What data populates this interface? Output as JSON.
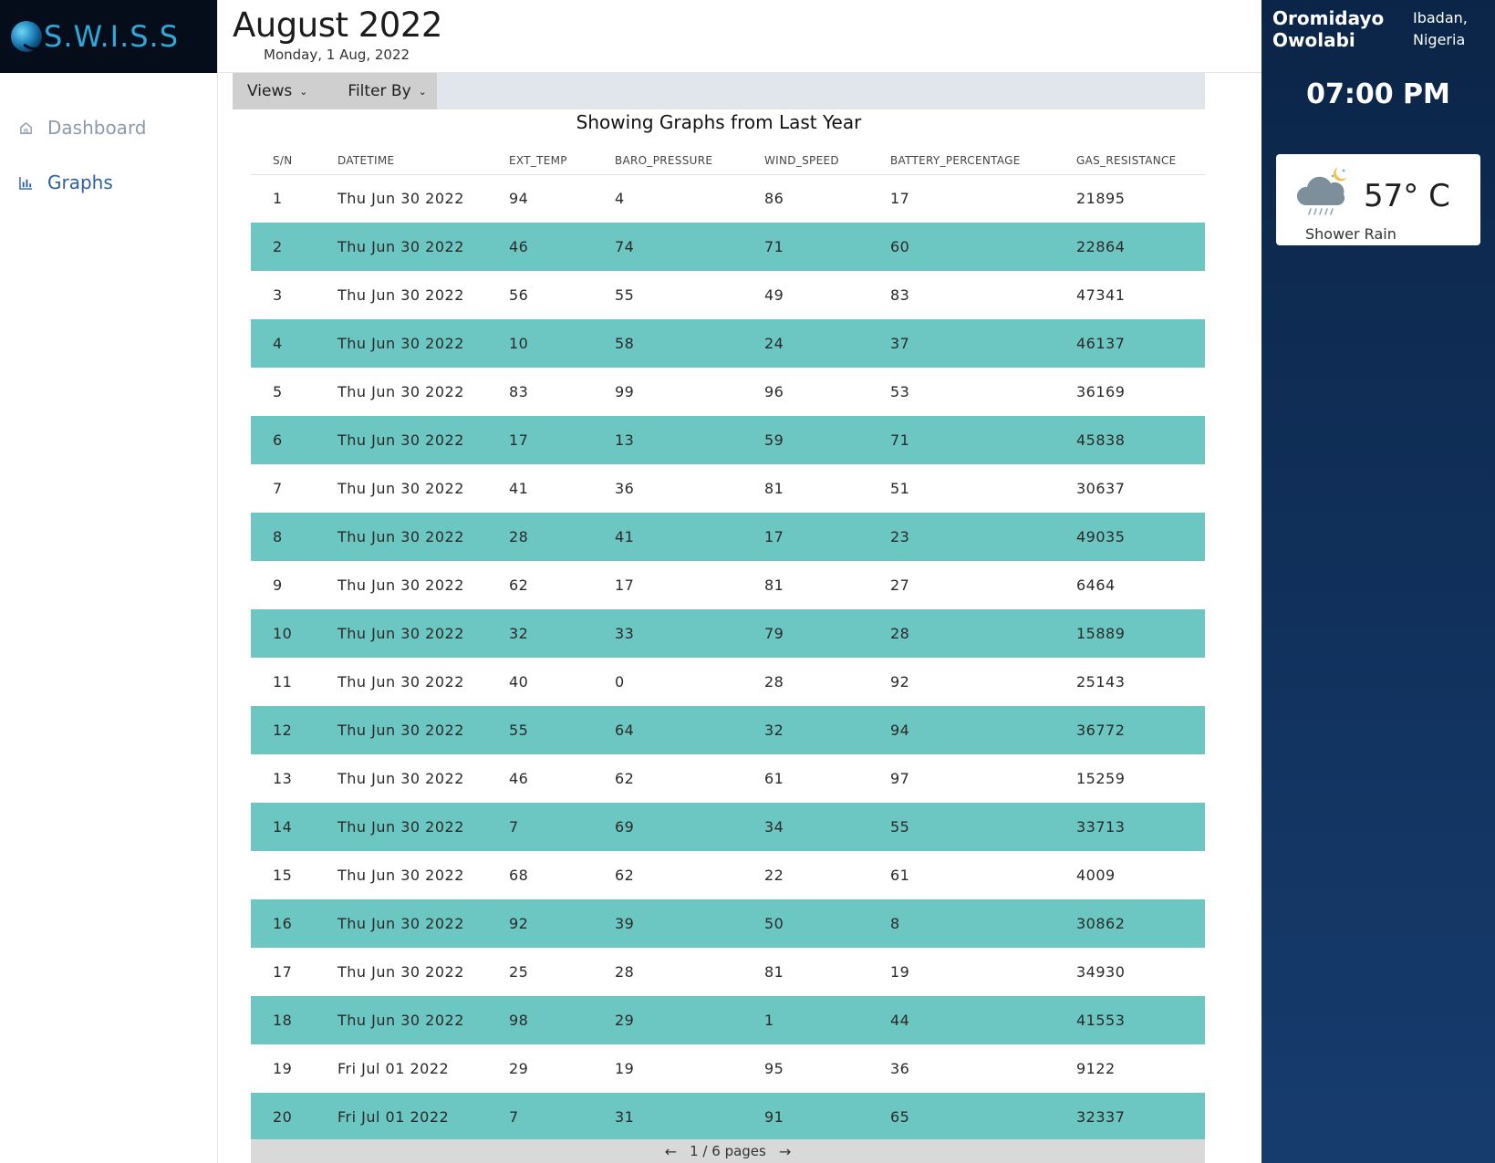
{
  "brand": {
    "logo_text": "S.W.I.S.S"
  },
  "sidebar": {
    "items": [
      {
        "label": "Dashboard",
        "icon": "home-icon"
      },
      {
        "label": "Graphs",
        "icon": "bar-chart-icon"
      }
    ]
  },
  "header": {
    "title": "August 2022",
    "date": "Monday, 1 Aug, 2022"
  },
  "toolbar": {
    "views_label": "Views",
    "filter_label": "Filter By"
  },
  "section_title": "Showing Graphs from Last Year",
  "table": {
    "columns": [
      "S/N",
      "DATETIME",
      "EXT_TEMP",
      "BARO_PRESSURE",
      "WIND_SPEED",
      "BATTERY_PERCENTAGE",
      "GAS_RESISTANCE"
    ],
    "rows": [
      [
        "1",
        "Thu Jun 30 2022",
        "94",
        "4",
        "86",
        "17",
        "21895"
      ],
      [
        "2",
        "Thu Jun 30 2022",
        "46",
        "74",
        "71",
        "60",
        "22864"
      ],
      [
        "3",
        "Thu Jun 30 2022",
        "56",
        "55",
        "49",
        "83",
        "47341"
      ],
      [
        "4",
        "Thu Jun 30 2022",
        "10",
        "58",
        "24",
        "37",
        "46137"
      ],
      [
        "5",
        "Thu Jun 30 2022",
        "83",
        "99",
        "96",
        "53",
        "36169"
      ],
      [
        "6",
        "Thu Jun 30 2022",
        "17",
        "13",
        "59",
        "71",
        "45838"
      ],
      [
        "7",
        "Thu Jun 30 2022",
        "41",
        "36",
        "81",
        "51",
        "30637"
      ],
      [
        "8",
        "Thu Jun 30 2022",
        "28",
        "41",
        "17",
        "23",
        "49035"
      ],
      [
        "9",
        "Thu Jun 30 2022",
        "62",
        "17",
        "81",
        "27",
        "6464"
      ],
      [
        "10",
        "Thu Jun 30 2022",
        "32",
        "33",
        "79",
        "28",
        "15889"
      ],
      [
        "11",
        "Thu Jun 30 2022",
        "40",
        "0",
        "28",
        "92",
        "25143"
      ],
      [
        "12",
        "Thu Jun 30 2022",
        "55",
        "64",
        "32",
        "94",
        "36772"
      ],
      [
        "13",
        "Thu Jun 30 2022",
        "46",
        "62",
        "61",
        "97",
        "15259"
      ],
      [
        "14",
        "Thu Jun 30 2022",
        "7",
        "69",
        "34",
        "55",
        "33713"
      ],
      [
        "15",
        "Thu Jun 30 2022",
        "68",
        "62",
        "22",
        "61",
        "4009"
      ],
      [
        "16",
        "Thu Jun 30 2022",
        "92",
        "39",
        "50",
        "8",
        "30862"
      ],
      [
        "17",
        "Thu Jun 30 2022",
        "25",
        "28",
        "81",
        "19",
        "34930"
      ],
      [
        "18",
        "Thu Jun 30 2022",
        "98",
        "29",
        "1",
        "44",
        "41553"
      ],
      [
        "19",
        "Fri Jul 01 2022",
        "29",
        "19",
        "95",
        "36",
        "9122"
      ],
      [
        "20",
        "Fri Jul 01 2022",
        "7",
        "31",
        "91",
        "65",
        "32337"
      ]
    ]
  },
  "pagination": {
    "text": "1 / 6 pages",
    "prev_icon": "arrow-left-icon",
    "next_icon": "arrow-right-icon"
  },
  "user": {
    "name": "Oromidayo Owolabi",
    "location": "Ibadan, Nigeria"
  },
  "clock": {
    "time": "07:00 PM"
  },
  "weather": {
    "temp": "57° C",
    "description": "Shower Rain",
    "icon": "cloud-rain-moon-icon"
  },
  "colors": {
    "accent_row": "#6cc6c2",
    "right_panel": "#0b2548",
    "nav_active": "#2b5f9e",
    "logo_bar": "#050c1a"
  }
}
